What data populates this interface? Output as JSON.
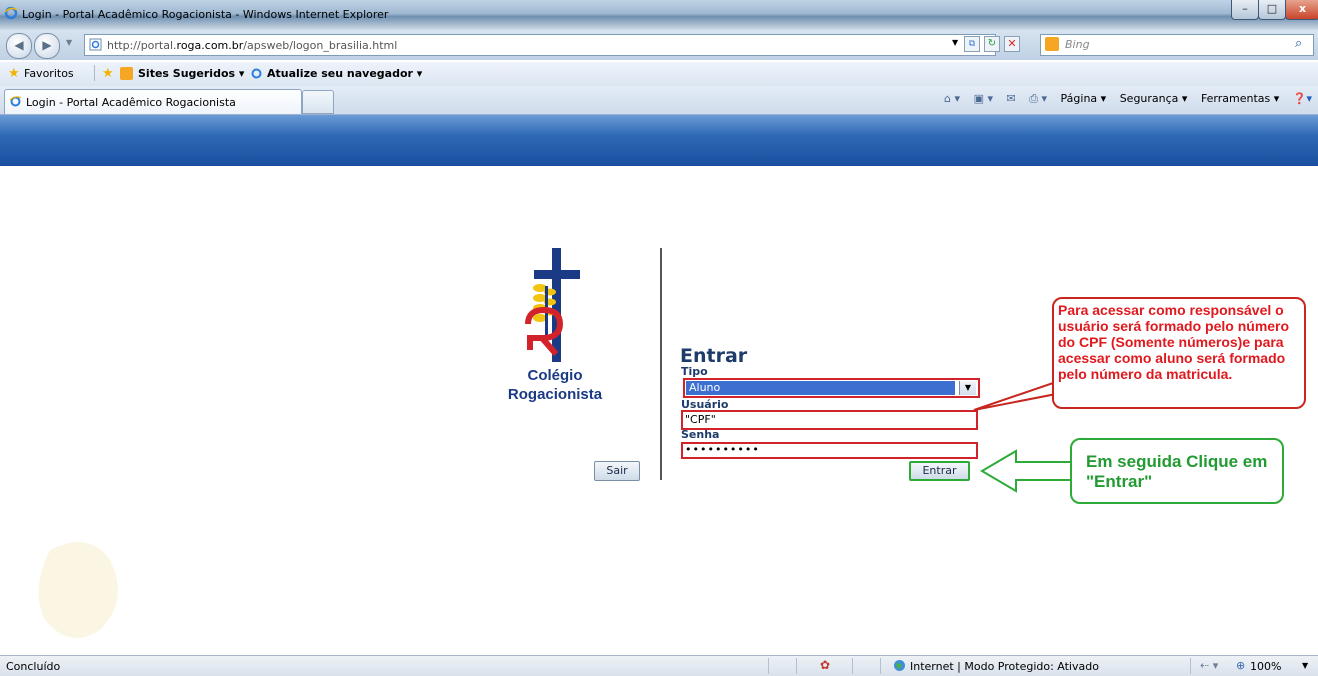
{
  "window": {
    "title": "Login - Portal Acadêmico Rogacionista - Windows Internet Explorer",
    "minimize_label": "–",
    "maximize_label": "□",
    "close_label": "x"
  },
  "addressbar": {
    "url_prefix": "http://portal.",
    "url_domain": "roga.com.br",
    "url_path": "/apsweb/logon_brasilia.html",
    "search_placeholder": "Bing"
  },
  "favorites": {
    "favorites_label": "Favoritos",
    "suggested_label": "Sites Sugeridos ▾",
    "update_label": "Atualize seu navegador ▾"
  },
  "tabs": {
    "active_label": "Login - Portal Acadêmico Rogacionista"
  },
  "commandbar": {
    "pagina": "Página ▾",
    "seguranca": "Segurança ▾",
    "ferramentas": "Ferramentas ▾"
  },
  "logo": {
    "line1": "Colégio",
    "line2": "Rogacionista"
  },
  "form": {
    "title": "Entrar",
    "tipo_label": "Tipo",
    "tipo_value": "Aluno",
    "usuario_label": "Usuário",
    "usuario_value": "\"CPF\"",
    "senha_label": "Senha",
    "senha_value": "••••••••••",
    "sair_button": "Sair",
    "entrar_button": "Entrar"
  },
  "callouts": {
    "red_text": "Para acessar como responsável o usuário será formado pelo número do CPF (Somente números)e para acessar como aluno será formado pelo número da matricula.",
    "green_text": "Em seguida Clique em \"Entrar\""
  },
  "statusbar": {
    "status": "Concluído",
    "zone": "Internet | Modo Protegido: Ativado",
    "zoom": "100%"
  },
  "colors": {
    "highlight_red": "#d2232a",
    "highlight_green": "#2eaa38",
    "header_blue": "#1a4fa0"
  }
}
